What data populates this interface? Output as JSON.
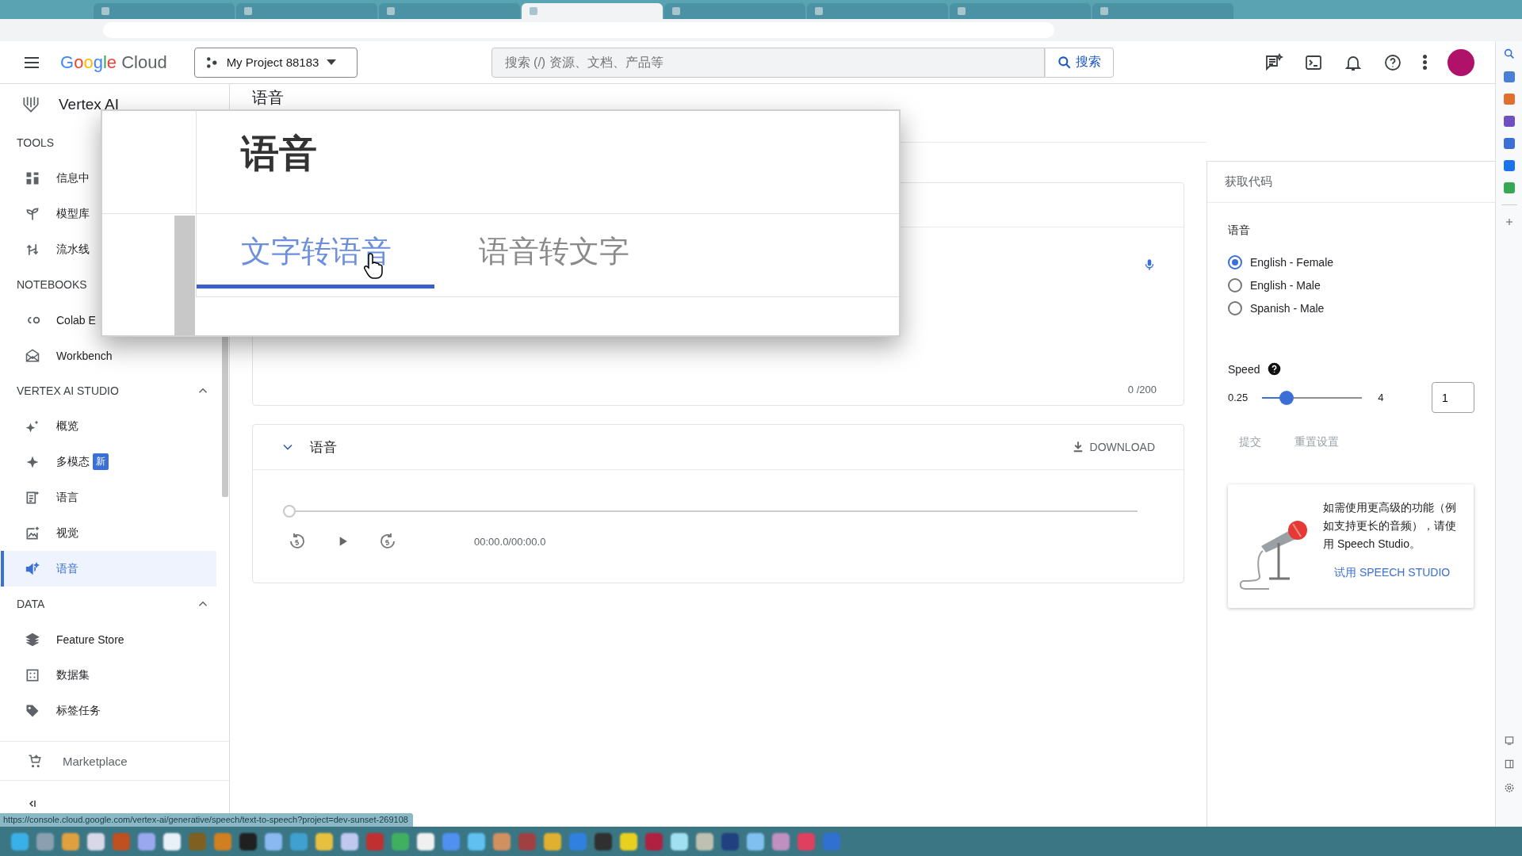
{
  "browser": {
    "tabs": [
      {
        "selected": false
      },
      {
        "selected": false
      },
      {
        "selected": false
      },
      {
        "selected": true
      },
      {
        "selected": false
      },
      {
        "selected": false
      },
      {
        "selected": false
      },
      {
        "selected": false
      }
    ]
  },
  "header": {
    "product": "Google Cloud",
    "project": "My Project 88183",
    "search": {
      "placeholder": "搜索 (/) 资源、文档、产品等",
      "button": "搜索"
    }
  },
  "sidebar": {
    "title": "Vertex AI",
    "sections": [
      {
        "heading": "TOOLS",
        "items": [
          {
            "label": "信息中",
            "selected": false
          },
          {
            "label": "模型库",
            "selected": false
          },
          {
            "label": "流水线",
            "selected": false
          }
        ]
      },
      {
        "heading": "NOTEBOOKS",
        "items": [
          {
            "label": "Colab E",
            "selected": false
          },
          {
            "label": "Workbench",
            "selected": false
          }
        ]
      },
      {
        "heading": "VERTEX AI STUDIO",
        "expanded": true,
        "items": [
          {
            "label": "概览",
            "selected": false
          },
          {
            "label": "多模态",
            "badge": "新",
            "selected": false
          },
          {
            "label": "语言",
            "selected": false
          },
          {
            "label": "视觉",
            "selected": false
          },
          {
            "label": "语音",
            "selected": true
          }
        ]
      },
      {
        "heading": "DATA",
        "expanded": true,
        "items": [
          {
            "label": "Feature Store",
            "selected": false
          },
          {
            "label": "数据集",
            "selected": false
          },
          {
            "label": "标签任务",
            "selected": false
          }
        ]
      }
    ],
    "footer_item": "Marketplace"
  },
  "page_title": "语音",
  "zoom_overlay": {
    "heading": "语音",
    "tabs": [
      {
        "label": "文字转语音",
        "selected": true
      },
      {
        "label": "语音转文字",
        "selected": false
      }
    ]
  },
  "text_card": {
    "counter": "0 /200"
  },
  "audio_card": {
    "title": "语音",
    "expanded": true,
    "download": "DOWNLOAD",
    "level": 0,
    "time": "00:00.0/00:00.0"
  },
  "right_panel": {
    "get_code": "获取代码",
    "voice_label": "语音",
    "voices": [
      {
        "label": "English - Female",
        "selected": true
      },
      {
        "label": "English - Male",
        "selected": false
      },
      {
        "label": "Spanish - Male",
        "selected": false
      }
    ],
    "speed": {
      "label": "Speed",
      "min": "0.25",
      "max": "4",
      "level": 0.2,
      "value": "1"
    },
    "actions": [
      {
        "label": "提交",
        "disabled": true
      },
      {
        "label": "重置设置",
        "disabled": true
      }
    ],
    "promo": {
      "text": "如需使用更高级的功能（例如支持更长的音频），请使用 Speech Studio。",
      "link": "试用 SPEECH STUDIO"
    }
  },
  "status_url": "https://console.cloud.google.com/vertex-ai/generative/speech/text-to-speech?project=dev-sunset-269108"
}
